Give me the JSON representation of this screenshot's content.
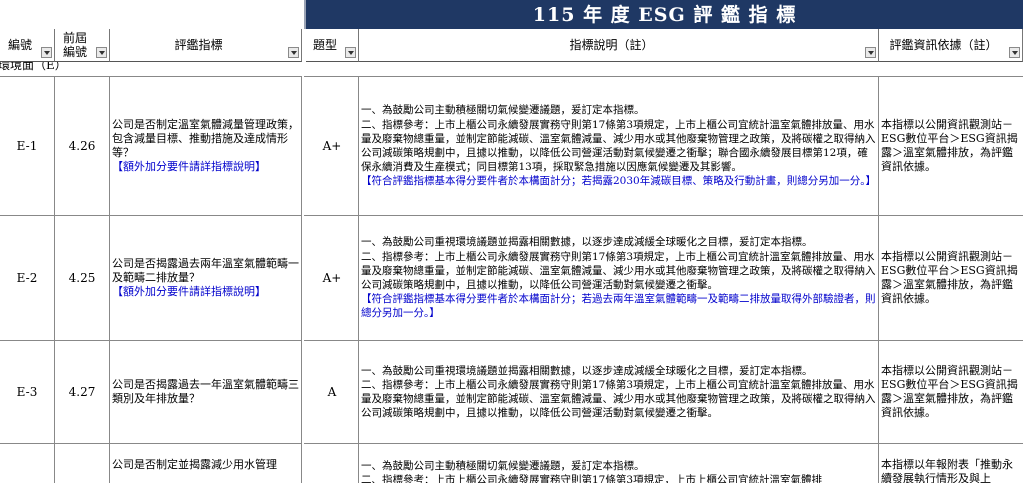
{
  "title": "115 年 度 ESG 評 鑑 指 標",
  "headers": {
    "id": "編號",
    "prev_id": "前屆\n編號",
    "indicator": "評鑑指標",
    "type": "題型",
    "explanation": "指標說明（註）",
    "basis": "評鑑資訊依據（註）"
  },
  "section_label": "環境面（E）",
  "rows": [
    {
      "id": "E-1",
      "prev_id": "4.26",
      "indicator": "公司是否制定溫室氣體減量管理政策，包含減量目標、推動措施及達成情形等？",
      "indicator_note": "【額外加分要件請詳指標說明】",
      "type": "A+",
      "explanation": "一、為鼓勵公司主動積極關切氣候變遷議題，爰訂定本指標。\n二、指標參考：上市上櫃公司永續發展實務守則第17條第3項規定，上市上櫃公司宜統計溫室氣體排放量、用水量及廢棄物總重量，並制定節能減碳、溫室氣體減量、減少用水或其他廢棄物管理之政策，及將碳權之取得納入公司減碳策略規劃中，且據以推動，以降低公司營運活動對氣候變遷之衝擊；聯合國永續發展目標第12項，確保永續消費及生產模式；同目標第13項，採取緊急措施以因應氣候變遷及其影響。",
      "explanation_note": "【符合評鑑指標基本得分要件者於本構面計分；若揭露2030年減碳目標、策略及行動計畫，則總分另加一分。】",
      "basis": "本指標以公開資訊觀測站－ESG數位平台＞ESG資訊揭露＞溫室氣體排放，為評鑑資訊依據。"
    },
    {
      "id": "E-2",
      "prev_id": "4.25",
      "indicator": "公司是否揭露過去兩年溫室氣體範疇一及範疇二排放量？",
      "indicator_note": "【額外加分要件請詳指標說明】",
      "type": "A+",
      "explanation": "一、為鼓勵公司重視環境議題並揭露相關數據，以逐步達成減緩全球暖化之目標，爰訂定本指標。\n二、指標參考：上市上櫃公司永續發展實務守則第17條第3項規定，上市上櫃公司宜統計溫室氣體排放量、用水量及廢棄物總重量，並制定節能減碳、溫室氣體減量、減少用水或其他廢棄物管理之政策，及將碳權之取得納入公司減碳策略規劃中，且據以推動，以降低公司營運活動對氣候變遷之衝擊。",
      "explanation_note": "【符合評鑑指標基本得分要件者於本構面計分；若過去兩年溫室氣體範疇一及範疇二排放量取得外部驗證者，則總分另加一分。】",
      "basis": "本指標以公開資訊觀測站－ESG數位平台＞ESG資訊揭露＞溫室氣體排放，為評鑑資訊依據。"
    },
    {
      "id": "E-3",
      "prev_id": "4.27",
      "indicator": "公司是否揭露過去一年溫室氣體範疇三類別及年排放量？",
      "indicator_note": "",
      "type": "A",
      "explanation": "一、為鼓勵公司重視環境議題並揭露相關數據，以逐步達成減緩全球暖化之目標，爰訂定本指標。\n二、指標參考：上市上櫃公司永續發展實務守則第17條第3項規定，上市上櫃公司宜統計溫室氣體排放量、用水量及廢棄物總重量，並制定節能減碳、溫室氣體減量、減少用水或其他廢棄物管理之政策，及將碳權之取得納入公司減碳策略規劃中，且據以推動，以降低公司營運活動對氣候變遷之衝擊。",
      "explanation_note": "",
      "basis": "本指標以公開資訊觀測站－ESG數位平台＞ESG資訊揭露＞溫室氣體排放，為評鑑資訊依據。"
    },
    {
      "id": "",
      "prev_id": "",
      "indicator": "公司是否制定並揭露減少用水管理",
      "indicator_note": "",
      "type": "",
      "explanation": "一、為鼓勵公司主動積極關切氣候變遷議題，爰訂定本指標。\n二、指標參考：上市上櫃公司永續發展實務守則第17條第3項規定，上市上櫃公司宜統計溫室氣體排",
      "explanation_note": "",
      "basis": "本指標以年報附表「推動永續發展執行情形及與上"
    }
  ]
}
